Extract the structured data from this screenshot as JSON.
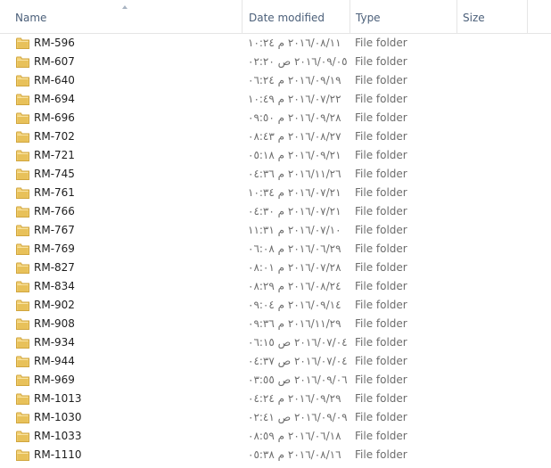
{
  "columns": {
    "name": "Name",
    "date": "Date modified",
    "type": "Type",
    "size": "Size"
  },
  "folder_color": "#e8c15a",
  "rows": [
    {
      "name": "RM-596",
      "date": "٢٠١٦/٠٨/١١ م ١٠:٢٤",
      "type": "File folder",
      "size": ""
    },
    {
      "name": "RM-607",
      "date": "٢٠١٦/٠٩/٠٥ ص ٠٢:٢٠",
      "type": "File folder",
      "size": ""
    },
    {
      "name": "RM-640",
      "date": "٢٠١٦/٠٩/١٩ م ٠٦:٢٤",
      "type": "File folder",
      "size": ""
    },
    {
      "name": "RM-694",
      "date": "٢٠١٦/٠٧/٢٢ م ١٠:٤٩",
      "type": "File folder",
      "size": ""
    },
    {
      "name": "RM-696",
      "date": "٢٠١٦/٠٩/٢٨ م ٠٩:٥٠",
      "type": "File folder",
      "size": ""
    },
    {
      "name": "RM-702",
      "date": "٢٠١٦/٠٨/٢٧ م ٠٨:٤٣",
      "type": "File folder",
      "size": ""
    },
    {
      "name": "RM-721",
      "date": "٢٠١٦/٠٩/٢١ م ٠٥:١٨",
      "type": "File folder",
      "size": ""
    },
    {
      "name": "RM-745",
      "date": "٢٠١٦/١١/٢٦ م ٠٤:٣٦",
      "type": "File folder",
      "size": ""
    },
    {
      "name": "RM-761",
      "date": "٢٠١٦/٠٧/٢١ م ١٠:٣٤",
      "type": "File folder",
      "size": ""
    },
    {
      "name": "RM-766",
      "date": "٢٠١٦/٠٧/٢١ م ٠٤:٣٠",
      "type": "File folder",
      "size": ""
    },
    {
      "name": "RM-767",
      "date": "٢٠١٦/٠٧/١٠ م ١١:٣١",
      "type": "File folder",
      "size": ""
    },
    {
      "name": "RM-769",
      "date": "٢٠١٦/٠٦/٢٩ م ٠٦:٠٨",
      "type": "File folder",
      "size": ""
    },
    {
      "name": "RM-827",
      "date": "٢٠١٦/٠٧/٢٨ م ٠٨:٠١",
      "type": "File folder",
      "size": ""
    },
    {
      "name": "RM-834",
      "date": "٢٠١٦/٠٨/٢٤ م ٠٨:٢٩",
      "type": "File folder",
      "size": ""
    },
    {
      "name": "RM-902",
      "date": "٢٠١٦/٠٩/١٤ م ٠٩:٠٤",
      "type": "File folder",
      "size": ""
    },
    {
      "name": "RM-908",
      "date": "٢٠١٦/١١/٢٩ م ٠٩:٣٦",
      "type": "File folder",
      "size": ""
    },
    {
      "name": "RM-934",
      "date": "٢٠١٦/٠٧/٠٤ ص ٠٦:١٥",
      "type": "File folder",
      "size": ""
    },
    {
      "name": "RM-944",
      "date": "٢٠١٦/٠٧/٠٤ ص ٠٤:٣٧",
      "type": "File folder",
      "size": ""
    },
    {
      "name": "RM-969",
      "date": "٢٠١٦/٠٩/٠٦ ص ٠٣:٥٥",
      "type": "File folder",
      "size": ""
    },
    {
      "name": "RM-1013",
      "date": "٢٠١٦/٠٩/٢٩ م ٠٤:٢٤",
      "type": "File folder",
      "size": ""
    },
    {
      "name": "RM-1030",
      "date": "٢٠١٦/٠٩/٠٩ ص ٠٢:٤١",
      "type": "File folder",
      "size": ""
    },
    {
      "name": "RM-1033",
      "date": "٢٠١٦/٠٦/١٨ م ٠٨:٥٩",
      "type": "File folder",
      "size": ""
    },
    {
      "name": "RM-1110",
      "date": "٢٠١٦/٠٨/١٦ م ٠٥:٣٨",
      "type": "File folder",
      "size": ""
    }
  ]
}
